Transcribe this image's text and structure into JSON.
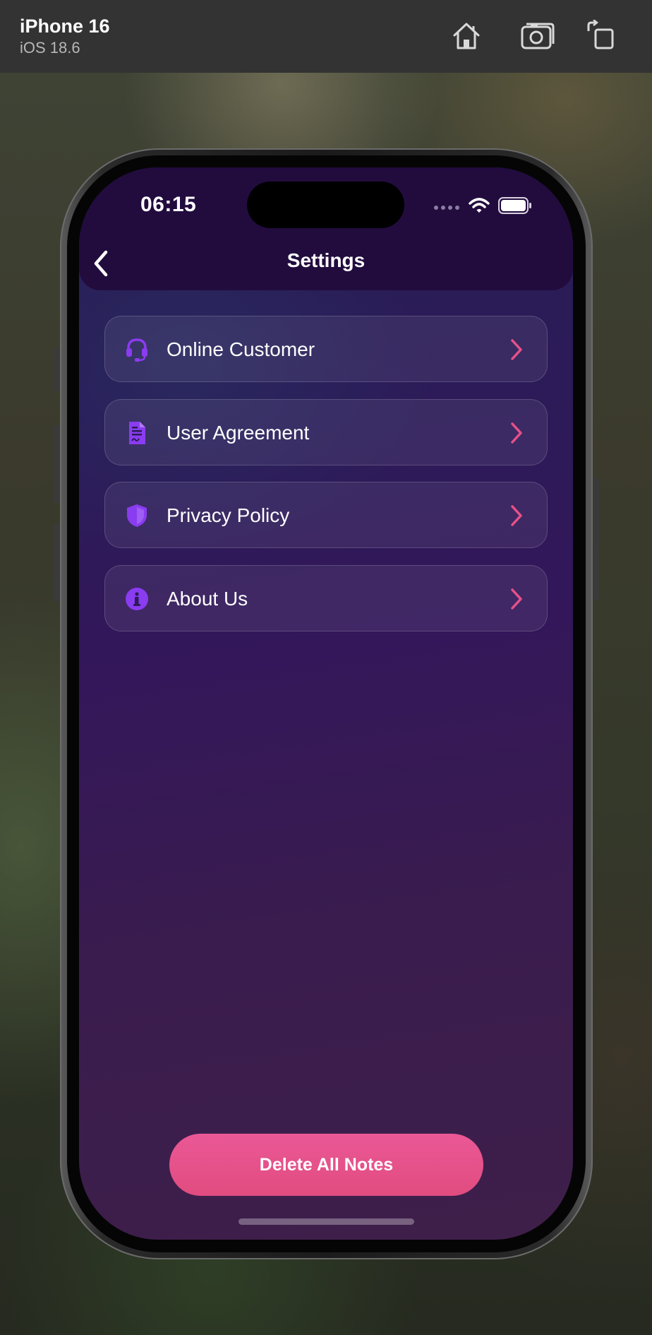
{
  "simulator": {
    "device_name": "iPhone 16",
    "os_version": "iOS 18.6",
    "buttons": [
      {
        "name": "home-icon"
      },
      {
        "name": "screenshot-icon"
      },
      {
        "name": "rotate-icon"
      }
    ]
  },
  "status_bar": {
    "time": "06:15",
    "icons": [
      "cellular-dots-icon",
      "wifi-icon",
      "battery-icon"
    ]
  },
  "nav": {
    "title": "Settings",
    "back_icon": "chevron-left-icon"
  },
  "menu": {
    "items": [
      {
        "label": "Online Customer",
        "icon": "headset-icon"
      },
      {
        "label": "User Agreement",
        "icon": "document-icon"
      },
      {
        "label": "Privacy Policy",
        "icon": "shield-icon"
      },
      {
        "label": "About Us",
        "icon": "info-icon"
      }
    ],
    "chevron_icon": "chevron-right-icon"
  },
  "actions": {
    "delete_label": "Delete All Notes"
  },
  "colors": {
    "accent_pink": "#e65188",
    "icon_purple": "#8a3cf0",
    "nav_bar": "#220c3e",
    "screen_top": "#281d55",
    "screen_bottom": "#3e1f4a"
  }
}
